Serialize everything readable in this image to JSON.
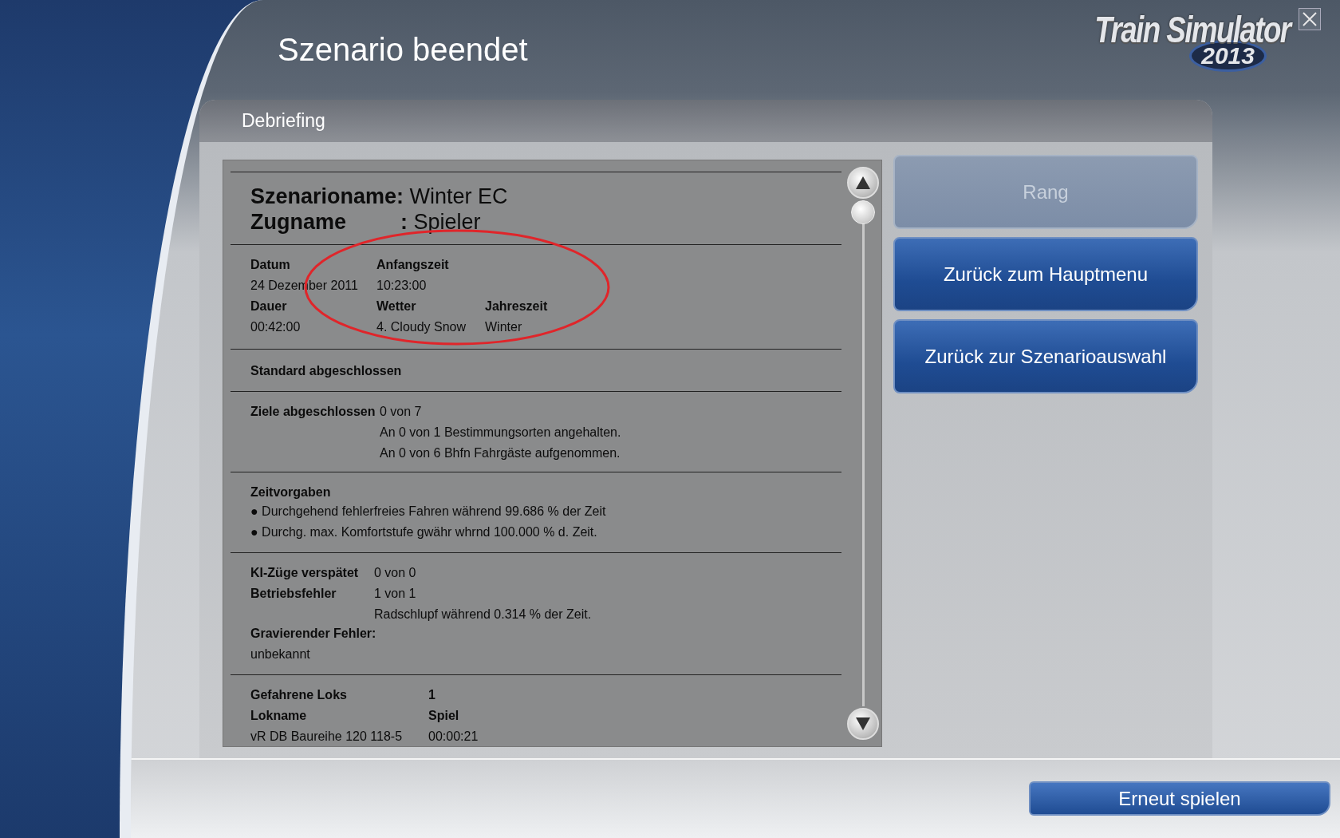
{
  "window": {
    "title": "Szenario beendet",
    "logo": {
      "title": "Train Simulator",
      "year": "2013"
    }
  },
  "panel": {
    "title": "Debriefing"
  },
  "report": {
    "scenario": {
      "label": "Szenarioname:",
      "value": "Winter EC"
    },
    "train": {
      "label": "Zugname",
      "separator": ":",
      "value": "Spieler"
    },
    "info": [
      [
        {
          "label": "Datum",
          "value": "24 Dezember 2011"
        },
        {
          "label": "Anfangszeit",
          "value": "10:23:00"
        }
      ],
      [
        {
          "label": "Dauer",
          "value": "00:42:00"
        },
        {
          "label": "Wetter",
          "value": "4. Cloudy Snow"
        },
        {
          "label": "Jahreszeit",
          "value": "Winter"
        }
      ]
    ],
    "standard": "Standard abgeschlossen",
    "goals": {
      "label": "Ziele abgeschlossen",
      "value": "0 von 7",
      "details": [
        "An 0 von 1 Bestimmungsorten angehalten.",
        "An 0 von 6 Bhfn Fahrgäste aufgenommen."
      ]
    },
    "time_targets": {
      "title": "Zeitvorgaben",
      "items": [
        "● Durchgehend fehlerfreies Fahren während 99.686 % der Zeit",
        "● Durchg. max. Komfortstufe gwähr whrnd 100.000 % d. Zeit."
      ]
    },
    "errors": [
      {
        "label": "KI-Züge verspätet",
        "value": "0 von 0"
      },
      {
        "label": "Betriebsfehler",
        "value": "1 von 1",
        "details": [
          "Radschlupf während 0.314 % der Zeit."
        ]
      }
    ],
    "serious": {
      "label": "Gravierender Fehler:",
      "value": "unbekannt"
    },
    "locos": {
      "label": "Gefahrene Loks",
      "value": "1",
      "columns": [
        "Lokname",
        "Spiel"
      ],
      "rows": [
        [
          "vR DB Baureihe 120 118-5",
          "00:00:21"
        ]
      ]
    }
  },
  "actions": [
    {
      "label": "Rang",
      "disabled": true
    },
    {
      "label": "Zurück zum Hauptmenu",
      "disabled": false
    },
    {
      "label": "Zurück zur Szenarioauswahl",
      "disabled": false
    }
  ],
  "footer": {
    "button": "Erneut spielen"
  }
}
